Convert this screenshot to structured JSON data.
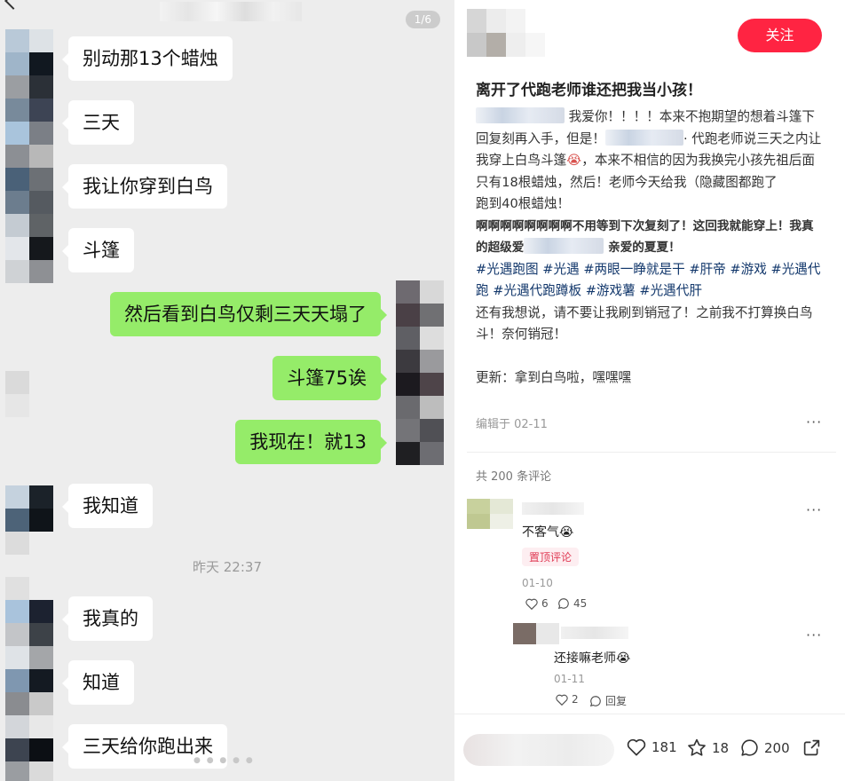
{
  "chat": {
    "page_indicator": "1/6",
    "timestamp": "昨天 22:37",
    "messages": [
      {
        "side": "in",
        "text": "别动那13个蜡烛"
      },
      {
        "side": "in",
        "text": "三天"
      },
      {
        "side": "in",
        "text": "我让你穿到白鸟"
      },
      {
        "side": "in",
        "text": "斗篷"
      },
      {
        "side": "out",
        "text": "然后看到白鸟仅剩三天天塌了"
      },
      {
        "side": "out",
        "text": "斗篷75诶"
      },
      {
        "side": "out",
        "text": "我现在！就13"
      },
      {
        "side": "in",
        "text": "我知道"
      },
      {
        "side": "in",
        "text": "我真的"
      },
      {
        "side": "in",
        "text": "知道"
      },
      {
        "side": "in",
        "text": "三天给你跑出来"
      }
    ]
  },
  "post": {
    "follow_label": "关注",
    "title": "离开了代跑老师谁还把我当小孩！",
    "body": {
      "p1_a": "我爱你！！！！本来不抱期望的想着斗篷下回复刻再入手，但是！",
      "p1_b": "· 代跑老师说三天之内让我穿上白鸟斗篷",
      "p1_c": "，本来不相信的因为我换完小孩先祖后面只有18根蜡烛，然后！老师今天给我（隐藏图都跑了",
      "p2": "跑到40根蜡烛！",
      "p3_a": "啊啊啊啊啊啊啊啊不用等到下次复刻了！这回我就能穿上！我真的超级爱",
      "p3_b": "亲爱的夏夏！",
      "tags": [
        "#光遇跑图",
        "#光遇",
        "#两眼一睁就是干",
        "#肝帝",
        "#游戏",
        "#光遇代跑",
        "#光遇代跑蹲板",
        "#游戏薯",
        "#光遇代肝"
      ],
      "p4": "还有我想说，请不要让我刷到销冠了！之前我不打算换白鸟斗！奈何销冠！",
      "p5": "更新：拿到白鸟啦，嘿嘿嘿"
    },
    "emoji_icon": "crying-face-icon",
    "edited": "编辑于 02-11",
    "comments_total": "共 200 条评论"
  },
  "comments": [
    {
      "text": "不客气",
      "pinned_label": "置顶评论",
      "date": "01-10",
      "likes": "6",
      "replies": "45"
    },
    {
      "text": "还接嘛老师",
      "date": "01-11",
      "likes": "2",
      "reply_label": "回复"
    }
  ],
  "actions": {
    "likes": "181",
    "stars": "18",
    "comments": "200"
  },
  "colors": {
    "accent": "#ff2442",
    "chat_out": "#95ec69",
    "chat_in": "#ffffff",
    "tag": "#13386c"
  }
}
